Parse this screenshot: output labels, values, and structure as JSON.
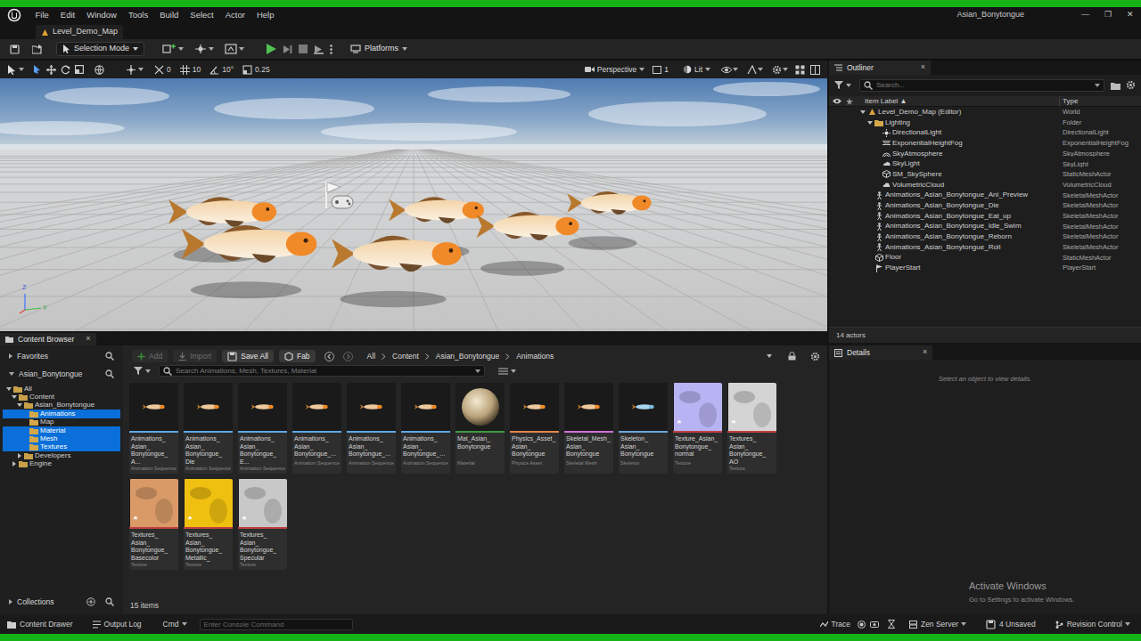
{
  "window": {
    "title": "Asian_Bonytongue",
    "controls": [
      "—",
      "❐",
      "✕"
    ]
  },
  "menu": [
    "File",
    "Edit",
    "Window",
    "Tools",
    "Build",
    "Select",
    "Actor",
    "Help"
  ],
  "level_tab": {
    "label": "Level_Demo_Map"
  },
  "toolbar": {
    "mode": "Selection Mode",
    "platforms": "Platforms"
  },
  "viewport": {
    "snap_values": [
      "0",
      "10",
      "10°",
      "0.25"
    ],
    "view_mode": "Perspective",
    "layout": "1",
    "lighting": "Lit",
    "axes": [
      "Z",
      "Y"
    ]
  },
  "outliner": {
    "tab": "Outliner",
    "close": "×",
    "search_placeholder": "Search...",
    "columns": [
      "Item Label ▲",
      "Type"
    ],
    "rows": [
      {
        "label": "Level_Demo_Map (Editor)",
        "type": "World",
        "depth": 0,
        "kind": "world",
        "expanded": true
      },
      {
        "label": "Lighting",
        "type": "Folder",
        "depth": 1,
        "kind": "folder",
        "expanded": true
      },
      {
        "label": "DirectionalLight",
        "type": "DirectionalLight",
        "depth": 2,
        "kind": "light",
        "expanded": false
      },
      {
        "label": "ExponentialHeightFog",
        "type": "ExponentialHeightFog",
        "depth": 2,
        "kind": "fog",
        "expanded": false
      },
      {
        "label": "SkyAtmosphere",
        "type": "SkyAtmosphere",
        "depth": 2,
        "kind": "atmosphere",
        "expanded": false
      },
      {
        "label": "SkyLight",
        "type": "SkyLight",
        "depth": 2,
        "kind": "skylight",
        "expanded": false
      },
      {
        "label": "SM_SkySphere",
        "type": "StaticMeshActor",
        "depth": 2,
        "kind": "mesh",
        "expanded": false
      },
      {
        "label": "VolumetricCloud",
        "type": "VolumetricCloud",
        "depth": 2,
        "kind": "cloud",
        "expanded": false
      },
      {
        "label": "Animations_Asian_Bonytongue_Ani_Preview",
        "type": "SkeletalMeshActor",
        "depth": 1,
        "kind": "skeletal",
        "expanded": false
      },
      {
        "label": "Animations_Asian_Bonytongue_Die",
        "type": "SkeletalMeshActor",
        "depth": 1,
        "kind": "skeletal",
        "expanded": false
      },
      {
        "label": "Animations_Asian_Bonytongue_Eat_up",
        "type": "SkeletalMeshActor",
        "depth": 1,
        "kind": "skeletal",
        "expanded": false
      },
      {
        "label": "Animations_Asian_Bonytongue_Idle_Swim",
        "type": "SkeletalMeshActor",
        "depth": 1,
        "kind": "skeletal",
        "expanded": false
      },
      {
        "label": "Animations_Asian_Bonytongue_Reborn",
        "type": "SkeletalMeshActor",
        "depth": 1,
        "kind": "skeletal",
        "expanded": false
      },
      {
        "label": "Animations_Asian_Bonytongue_Roll",
        "type": "SkeletalMeshActor",
        "depth": 1,
        "kind": "skeletal",
        "expanded": false
      },
      {
        "label": "Floor",
        "type": "StaticMeshActor",
        "depth": 1,
        "kind": "mesh",
        "expanded": false
      },
      {
        "label": "PlayerStart",
        "type": "PlayerStart",
        "depth": 1,
        "kind": "playerstart",
        "expanded": false
      }
    ],
    "count": "14 actors"
  },
  "details": {
    "tab": "Details",
    "close": "×",
    "message": "Select an object to view details."
  },
  "content_browser": {
    "tab": "Content Browser",
    "close": "×",
    "favorites": "Favorites",
    "root": "Asian_Bonytongue",
    "collections": "Collections",
    "tree": [
      {
        "label": "All",
        "depth": 0,
        "kind": "open",
        "selected": false
      },
      {
        "label": "Content",
        "depth": 1,
        "kind": "open",
        "selected": false
      },
      {
        "label": "Asian_Bonytongue",
        "depth": 2,
        "kind": "open",
        "selected": false
      },
      {
        "label": "Animations",
        "depth": 3,
        "kind": "leaf",
        "selected": true
      },
      {
        "label": "Map",
        "depth": 3,
        "kind": "leaf",
        "selected": false
      },
      {
        "label": "Material",
        "depth": 3,
        "kind": "leaf",
        "selected": true
      },
      {
        "label": "Mesh",
        "depth": 3,
        "kind": "leaf",
        "selected": true
      },
      {
        "label": "Textures",
        "depth": 3,
        "kind": "leaf",
        "selected": true
      },
      {
        "label": "Developers",
        "depth": 2,
        "kind": "closed",
        "selected": false
      },
      {
        "label": "Engine",
        "depth": 1,
        "kind": "closed",
        "selected": false
      }
    ],
    "buttons": [
      {
        "label": "Add",
        "kind": "add",
        "disabled": true
      },
      {
        "label": "Import",
        "kind": "import",
        "disabled": true
      },
      {
        "label": "Save All",
        "kind": "save",
        "disabled": false
      },
      {
        "label": "Fab",
        "kind": "fab",
        "disabled": false
      }
    ],
    "breadcrumb": [
      "All",
      "Content",
      "Asian_Bonytongue",
      "Animations"
    ],
    "search_placeholder": "Search Animations, Mesh, Textures, Material",
    "assets": [
      {
        "name": "Animations_Asian_Bonytongue_A...",
        "type": "Animation Sequence",
        "kind": "animation",
        "color": "#5ea8e6",
        "thumb": "#edc89c"
      },
      {
        "name": "Animations_Asian_Bonytongue_Die",
        "type": "Animation Sequence",
        "kind": "animation",
        "color": "#5ea8e6",
        "thumb": "#edc89c"
      },
      {
        "name": "Animations_Asian_Bonytongue_E...",
        "type": "Animation Sequence",
        "kind": "animation",
        "color": "#5ea8e6",
        "thumb": "#edc89c"
      },
      {
        "name": "Animations_Asian_Bonytongue_...",
        "type": "Animation Sequence",
        "kind": "animation",
        "color": "#5ea8e6",
        "thumb": "#edc89c"
      },
      {
        "name": "Animations_Asian_Bonytongue_...",
        "type": "Animation Sequence",
        "kind": "animation",
        "color": "#5ea8e6",
        "thumb": "#edc89c"
      },
      {
        "name": "Animations_Asian_Bonytongue_...",
        "type": "Animation Sequence",
        "kind": "animation",
        "color": "#5ea8e6",
        "thumb": "#edc89c"
      },
      {
        "name": "Mat_Asian_Bonytongue",
        "type": "Material",
        "kind": "material",
        "color": "#3f9b43",
        "thumb": "#b9a27a"
      },
      {
        "name": "Physics_Asset_Asian_Bonytongue",
        "type": "Physics Asset",
        "kind": "physics",
        "color": "#e0884a",
        "thumb": "#edc89c"
      },
      {
        "name": "Skeletal_Mesh_Asian_Bonytongue",
        "type": "Skeletal Mesh",
        "kind": "mesh",
        "color": "#d070d8",
        "thumb": "#edc89c"
      },
      {
        "name": "Skeleton_Asian_Bonytongue",
        "type": "Skeleton",
        "kind": "skeleton",
        "color": "#6aa8e0",
        "thumb": "#a8d4ee"
      },
      {
        "name": "Texture_Asian_Bonytongue_normal",
        "type": "Texture",
        "kind": "texture",
        "color": "#c04040",
        "thumb": "#b8b4f4"
      },
      {
        "name": "Textures_Asian_Bonytongue_AO",
        "type": "Texture",
        "kind": "texture",
        "color": "#c04040",
        "thumb": "#d4d4d4"
      },
      {
        "name": "Textures_Asian_Bonytongue_Basecolor",
        "type": "Texture",
        "kind": "texture",
        "color": "#c04040",
        "thumb": "#d99a68"
      },
      {
        "name": "Textures_Asian_Bonytongue_Metallic_",
        "type": "Texture",
        "kind": "texture",
        "color": "#c04040",
        "thumb": "#f0c010"
      },
      {
        "name": "Textures_Asian_Bonytongue_Specular",
        "type": "Texture",
        "kind": "texture",
        "color": "#c04040",
        "thumb": "#c8c8c8"
      }
    ],
    "count": "15 items"
  },
  "status_bar": {
    "left": [
      {
        "label": "Content Drawer",
        "kind": "drawer"
      },
      {
        "label": "Output Log",
        "kind": "log"
      }
    ],
    "cmd": "Cmd",
    "console_placeholder": "Enter Console Command",
    "right": [
      {
        "label": "Trace",
        "kind": "trace"
      },
      {
        "label": "Zen Server",
        "kind": "server"
      },
      {
        "label": "4 Unsaved",
        "kind": "unsaved"
      },
      {
        "label": "Revision Control",
        "kind": "revision"
      }
    ]
  },
  "watermark": {
    "title": "Activate Windows",
    "subtitle": "Go to Settings to activate Windows."
  }
}
